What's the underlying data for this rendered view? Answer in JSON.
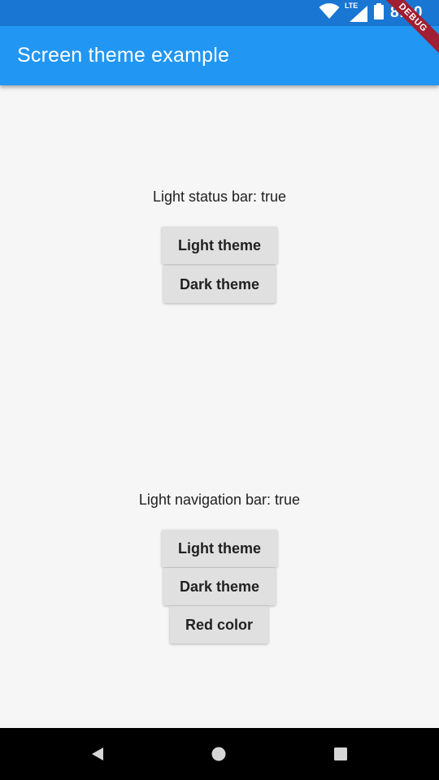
{
  "status_bar": {
    "time": "8:00",
    "network": "LTE",
    "icons": [
      "wifi-icon",
      "lte-signal-icon",
      "battery-icon"
    ],
    "color": "#1976d2"
  },
  "app_bar": {
    "title": "Screen theme example",
    "color": "#2196f3"
  },
  "debug_banner": {
    "label": "DEBUG",
    "color": "#a01f32"
  },
  "status_bar_section": {
    "caption": "Light status bar: true",
    "buttons": [
      "Light theme",
      "Dark theme"
    ]
  },
  "navigation_bar_section": {
    "caption": "Light navigation bar: true",
    "buttons": [
      "Light theme",
      "Dark theme",
      "Red color"
    ]
  },
  "system_nav": {
    "icons": [
      "back-icon",
      "home-icon",
      "recents-icon"
    ]
  }
}
